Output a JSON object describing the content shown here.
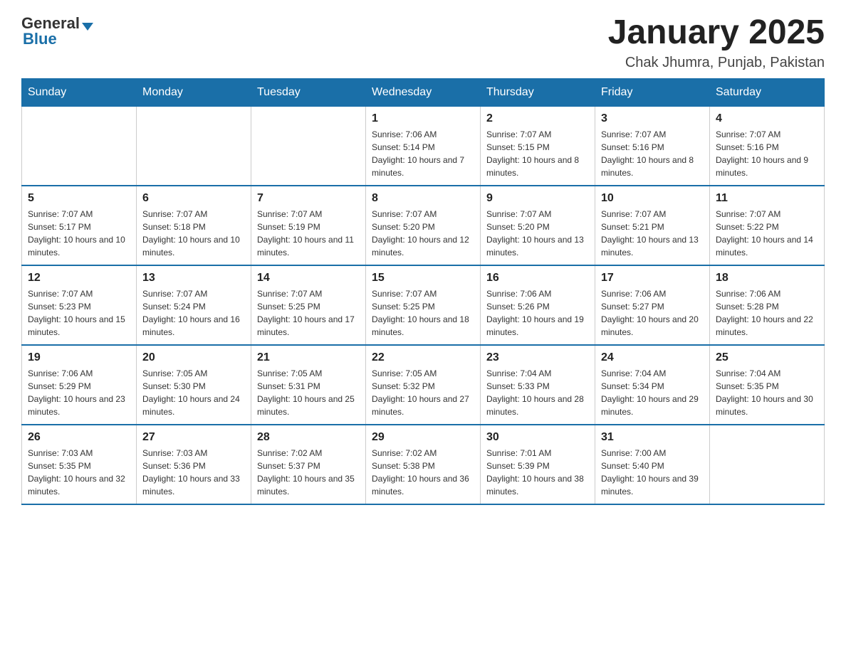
{
  "header": {
    "logo": {
      "general": "General",
      "blue": "Blue"
    },
    "title": "January 2025",
    "location": "Chak Jhumra, Punjab, Pakistan"
  },
  "calendar": {
    "days_of_week": [
      "Sunday",
      "Monday",
      "Tuesday",
      "Wednesday",
      "Thursday",
      "Friday",
      "Saturday"
    ],
    "weeks": [
      [
        {
          "day": "",
          "info": ""
        },
        {
          "day": "",
          "info": ""
        },
        {
          "day": "",
          "info": ""
        },
        {
          "day": "1",
          "info": "Sunrise: 7:06 AM\nSunset: 5:14 PM\nDaylight: 10 hours and 7 minutes."
        },
        {
          "day": "2",
          "info": "Sunrise: 7:07 AM\nSunset: 5:15 PM\nDaylight: 10 hours and 8 minutes."
        },
        {
          "day": "3",
          "info": "Sunrise: 7:07 AM\nSunset: 5:16 PM\nDaylight: 10 hours and 8 minutes."
        },
        {
          "day": "4",
          "info": "Sunrise: 7:07 AM\nSunset: 5:16 PM\nDaylight: 10 hours and 9 minutes."
        }
      ],
      [
        {
          "day": "5",
          "info": "Sunrise: 7:07 AM\nSunset: 5:17 PM\nDaylight: 10 hours and 10 minutes."
        },
        {
          "day": "6",
          "info": "Sunrise: 7:07 AM\nSunset: 5:18 PM\nDaylight: 10 hours and 10 minutes."
        },
        {
          "day": "7",
          "info": "Sunrise: 7:07 AM\nSunset: 5:19 PM\nDaylight: 10 hours and 11 minutes."
        },
        {
          "day": "8",
          "info": "Sunrise: 7:07 AM\nSunset: 5:20 PM\nDaylight: 10 hours and 12 minutes."
        },
        {
          "day": "9",
          "info": "Sunrise: 7:07 AM\nSunset: 5:20 PM\nDaylight: 10 hours and 13 minutes."
        },
        {
          "day": "10",
          "info": "Sunrise: 7:07 AM\nSunset: 5:21 PM\nDaylight: 10 hours and 13 minutes."
        },
        {
          "day": "11",
          "info": "Sunrise: 7:07 AM\nSunset: 5:22 PM\nDaylight: 10 hours and 14 minutes."
        }
      ],
      [
        {
          "day": "12",
          "info": "Sunrise: 7:07 AM\nSunset: 5:23 PM\nDaylight: 10 hours and 15 minutes."
        },
        {
          "day": "13",
          "info": "Sunrise: 7:07 AM\nSunset: 5:24 PM\nDaylight: 10 hours and 16 minutes."
        },
        {
          "day": "14",
          "info": "Sunrise: 7:07 AM\nSunset: 5:25 PM\nDaylight: 10 hours and 17 minutes."
        },
        {
          "day": "15",
          "info": "Sunrise: 7:07 AM\nSunset: 5:25 PM\nDaylight: 10 hours and 18 minutes."
        },
        {
          "day": "16",
          "info": "Sunrise: 7:06 AM\nSunset: 5:26 PM\nDaylight: 10 hours and 19 minutes."
        },
        {
          "day": "17",
          "info": "Sunrise: 7:06 AM\nSunset: 5:27 PM\nDaylight: 10 hours and 20 minutes."
        },
        {
          "day": "18",
          "info": "Sunrise: 7:06 AM\nSunset: 5:28 PM\nDaylight: 10 hours and 22 minutes."
        }
      ],
      [
        {
          "day": "19",
          "info": "Sunrise: 7:06 AM\nSunset: 5:29 PM\nDaylight: 10 hours and 23 minutes."
        },
        {
          "day": "20",
          "info": "Sunrise: 7:05 AM\nSunset: 5:30 PM\nDaylight: 10 hours and 24 minutes."
        },
        {
          "day": "21",
          "info": "Sunrise: 7:05 AM\nSunset: 5:31 PM\nDaylight: 10 hours and 25 minutes."
        },
        {
          "day": "22",
          "info": "Sunrise: 7:05 AM\nSunset: 5:32 PM\nDaylight: 10 hours and 27 minutes."
        },
        {
          "day": "23",
          "info": "Sunrise: 7:04 AM\nSunset: 5:33 PM\nDaylight: 10 hours and 28 minutes."
        },
        {
          "day": "24",
          "info": "Sunrise: 7:04 AM\nSunset: 5:34 PM\nDaylight: 10 hours and 29 minutes."
        },
        {
          "day": "25",
          "info": "Sunrise: 7:04 AM\nSunset: 5:35 PM\nDaylight: 10 hours and 30 minutes."
        }
      ],
      [
        {
          "day": "26",
          "info": "Sunrise: 7:03 AM\nSunset: 5:35 PM\nDaylight: 10 hours and 32 minutes."
        },
        {
          "day": "27",
          "info": "Sunrise: 7:03 AM\nSunset: 5:36 PM\nDaylight: 10 hours and 33 minutes."
        },
        {
          "day": "28",
          "info": "Sunrise: 7:02 AM\nSunset: 5:37 PM\nDaylight: 10 hours and 35 minutes."
        },
        {
          "day": "29",
          "info": "Sunrise: 7:02 AM\nSunset: 5:38 PM\nDaylight: 10 hours and 36 minutes."
        },
        {
          "day": "30",
          "info": "Sunrise: 7:01 AM\nSunset: 5:39 PM\nDaylight: 10 hours and 38 minutes."
        },
        {
          "day": "31",
          "info": "Sunrise: 7:00 AM\nSunset: 5:40 PM\nDaylight: 10 hours and 39 minutes."
        },
        {
          "day": "",
          "info": ""
        }
      ]
    ]
  }
}
